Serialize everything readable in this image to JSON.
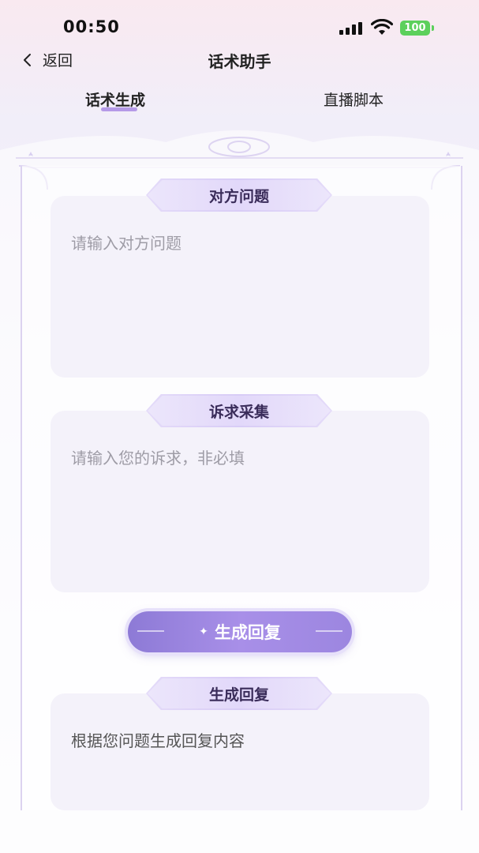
{
  "status": {
    "time": "00:50",
    "battery": "100"
  },
  "nav": {
    "back_label": "返回",
    "title": "话术助手"
  },
  "tabs": [
    {
      "label": "话术生成",
      "active": true
    },
    {
      "label": "直播脚本",
      "active": false
    }
  ],
  "sections": {
    "question": {
      "label": "对方问题",
      "placeholder": "请输入对方问题"
    },
    "appeal": {
      "label": "诉求采集",
      "placeholder": "请输入您的诉求，非必填"
    },
    "reply": {
      "label": "生成回复",
      "content": "根据您问题生成回复内容"
    }
  },
  "generate_button": {
    "label": "生成回复",
    "icon": "sparkle-icon"
  },
  "colors": {
    "accent": "#a88fe8",
    "label_bg": "#e2d8fa",
    "input_bg": "#f4f2fa"
  }
}
